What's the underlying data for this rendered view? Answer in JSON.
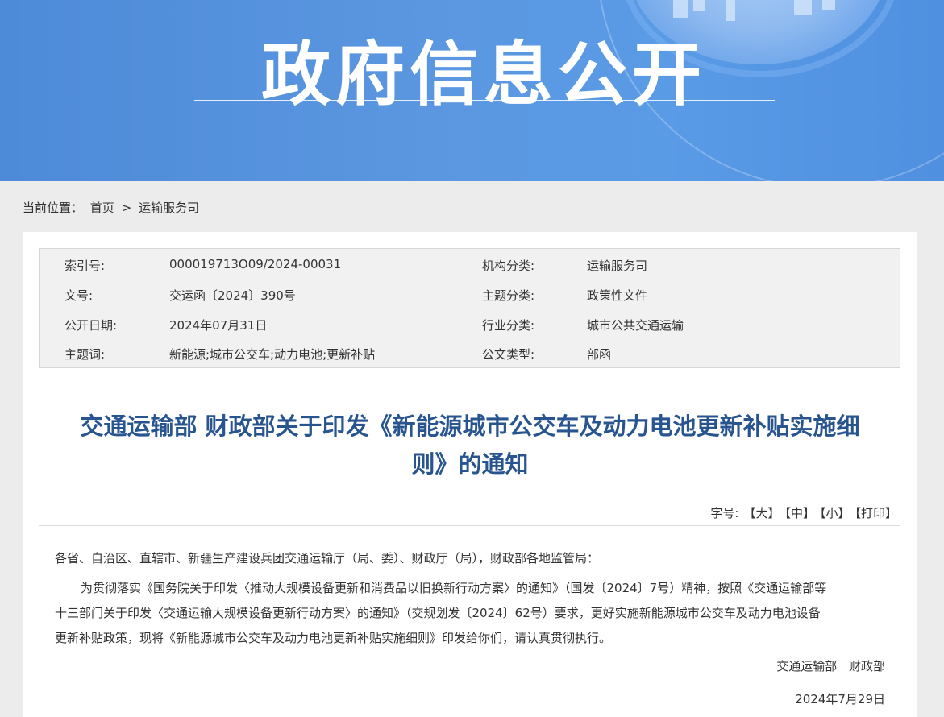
{
  "banner": {
    "title": "政府信息公开"
  },
  "breadcrumb": {
    "label": "当前位置：",
    "home": "首页",
    "separator": ">",
    "current": "运输服务司"
  },
  "meta": {
    "rows": [
      {
        "l1": "索引号:",
        "v1": "000019713O09/2024-00031",
        "l2": "机构分类:",
        "v2": "运输服务司"
      },
      {
        "l1": "文号:",
        "v1": "交运函〔2024〕390号",
        "l2": "主题分类:",
        "v2": "政策性文件"
      },
      {
        "l1": "公开日期:",
        "v1": "2024年07月31日",
        "l2": "行业分类:",
        "v2": "城市公共交通运输"
      },
      {
        "l1": "主题词:",
        "v1": "新能源;城市公交车;动力电池;更新补贴",
        "l2": "公文类型:",
        "v2": "部函"
      }
    ]
  },
  "article": {
    "title_line1": "交通运输部 财政部关于印发《新能源城市公交车及动力电池更新补贴实施细",
    "title_line2": "则》的通知",
    "tools": {
      "label": "字号:",
      "large": "【大】",
      "medium": "【中】",
      "small": "【小】",
      "print": "【打印】"
    },
    "salutation": "各省、自治区、直辖市、新疆生产建设兵团交通运输厅（局、委）、财政厅（局），财政部各地监管局：",
    "para_line1": "为贯彻落实《国务院关于印发〈推动大规模设备更新和消费品以旧换新行动方案〉的通知》（国发〔2024〕7号）精神，按照《交通运输部等",
    "para_line2": "十三部门关于印发〈交通运输大规模设备更新行动方案〉的通知》（交规划发〔2024〕62号）要求，更好实施新能源城市公交车及动力电池设备",
    "para_line3": "更新补贴政策，现将《新能源城市公交车及动力电池更新补贴实施细则》印发给你们，请认真贯彻执行。",
    "signer1": "交通运输部",
    "signer2": "财政部",
    "date": "2024年7月29日"
  },
  "colors": {
    "banner": "#5a97e0",
    "title": "#28548f",
    "page_bg": "#ececec",
    "meta_bg": "#f1f1f1"
  }
}
